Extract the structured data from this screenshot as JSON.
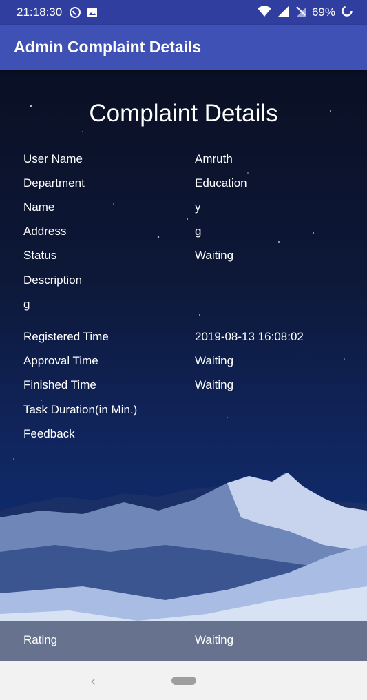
{
  "status_bar": {
    "time": "21:18:30",
    "battery": "69%",
    "icons": [
      "whatsapp-icon",
      "image-icon",
      "wifi-icon",
      "signal-icon",
      "no-sim-icon",
      "battery-icon"
    ]
  },
  "app_bar": {
    "title": "Admin Complaint Details"
  },
  "heading": "Complaint Details",
  "fields": {
    "user_name": {
      "label": "User Name",
      "value": "Amruth"
    },
    "department": {
      "label": "Department",
      "value": "Education"
    },
    "name": {
      "label": "Name",
      "value": "y"
    },
    "address": {
      "label": "Address",
      "value": "g"
    },
    "status": {
      "label": "Status",
      "value": "Waiting"
    },
    "description": {
      "label": "Description",
      "value": "g"
    },
    "registered_time": {
      "label": "Registered Time",
      "value": "2019-08-13 16:08:02"
    },
    "approval_time": {
      "label": "Approval Time",
      "value": "Waiting"
    },
    "finished_time": {
      "label": "Finished Time",
      "value": "Waiting"
    },
    "task_duration": {
      "label": "Task Duration(in Min.)"
    },
    "feedback": {
      "label": "Feedback"
    },
    "rating": {
      "label": "Rating",
      "value": "Waiting"
    }
  },
  "nav_bar": {
    "back_glyph": "‹"
  },
  "colors": {
    "status_bar": "#303f9f",
    "app_bar": "#3f51b5",
    "nav_bar": "#f2f2f2"
  }
}
